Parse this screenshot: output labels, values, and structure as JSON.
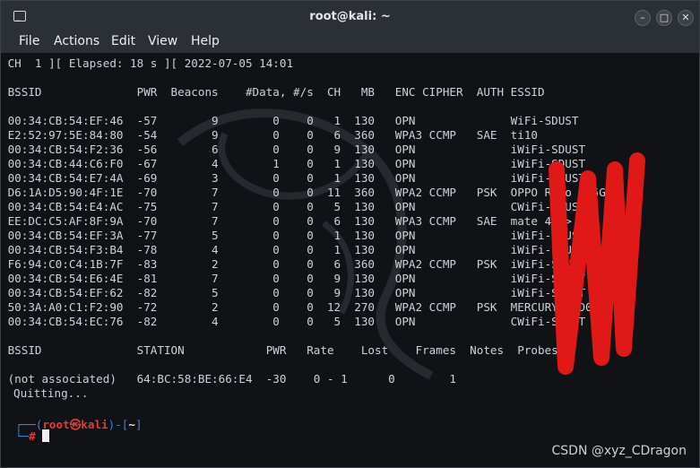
{
  "window": {
    "title": "root@kali: ~"
  },
  "menu": [
    "File",
    "Actions",
    "Edit",
    "View",
    "Help"
  ],
  "terminal": {
    "status_line": " CH  1 ][ Elapsed: 18 s ][ 2022-07-05 14:01",
    "ap_header": " BSSID              PWR  Beacons    #Data, #/s  CH   MB   ENC CIPHER  AUTH ESSID",
    "ap_rows": [
      " 00:34:CB:54:EF:46  -57        9        0    0   1  130   OPN              WiFi-SDUST",
      " E2:52:97:5E:84:80  -54        9        0    0   6  360   WPA3 CCMP   SAE  ti10",
      " 00:34:CB:54:F2:36  -56        6        0    0   9  130   OPN              iWiFi-SDUST",
      " 00:34:CB:44:C6:F0  -67        4        1    0   1  130   OPN              iWiFi-SDUST",
      " 00:34:CB:54:E7:4A  -69        3        0    0   1  130   OPN              iWiFi-SDUST",
      " D6:1A:D5:90:4F:1E  -70        7        0    0  11  360   WPA2 CCMP   PSK  OPPO Reno 4 5G",
      " 00:34:CB:54:E4:AC  -75        7        0    0   5  130   OPN              CWiFi-SDUST",
      " EE:DC:C5:AF:8F:9A  -70        7        0    0   6  130   WPA3 CCMP   SAE  mate 40 >",
      " 00:34:CB:54:EF:3A  -77        5        0    0   1  130   OPN              iWiFi-SDUST",
      " 00:34:CB:54:F3:B4  -78        4        0    0   1  130   OPN              iWiFi-SDUST",
      " F6:94:C0:C4:1B:7F  -83        2        0    0   6  360   WPA2 CCMP   PSK  iWiFi-SDUST",
      " 00:34:CB:54:E6:4E  -81        7        0    0   9  130   OPN              iWiFi-SDUST",
      " 00:34:CB:54:EF:62  -82        5        0    0   9  130   OPN              iWiFi-SDUST",
      " 50:3A:A0:C1:F2:90  -72        2        0    0  12  270   WPA2 CCMP   PSK  MERCURY_F2D0",
      " 00:34:CB:54:EC:76  -82        4        0    0   5  130   OPN              CWiFi-SDUST"
    ],
    "station_header": " BSSID              STATION            PWR   Rate    Lost    Frames  Notes  Probes",
    "station_rows": [
      " (not associated)   64:BC:58:BE:66:E4  -30    0 - 1      0        1"
    ],
    "quit_line": "Quitting...",
    "prompt": {
      "user": "root",
      "at": "㉿",
      "host": "kali",
      "dir": "~",
      "symbol": "#"
    }
  },
  "watermark": "CSDN @xyz_CDragon",
  "colors": {
    "prompt_red": "#e03b3b",
    "prompt_blue": "#3a82d6",
    "scribble_red": "#e01818"
  }
}
